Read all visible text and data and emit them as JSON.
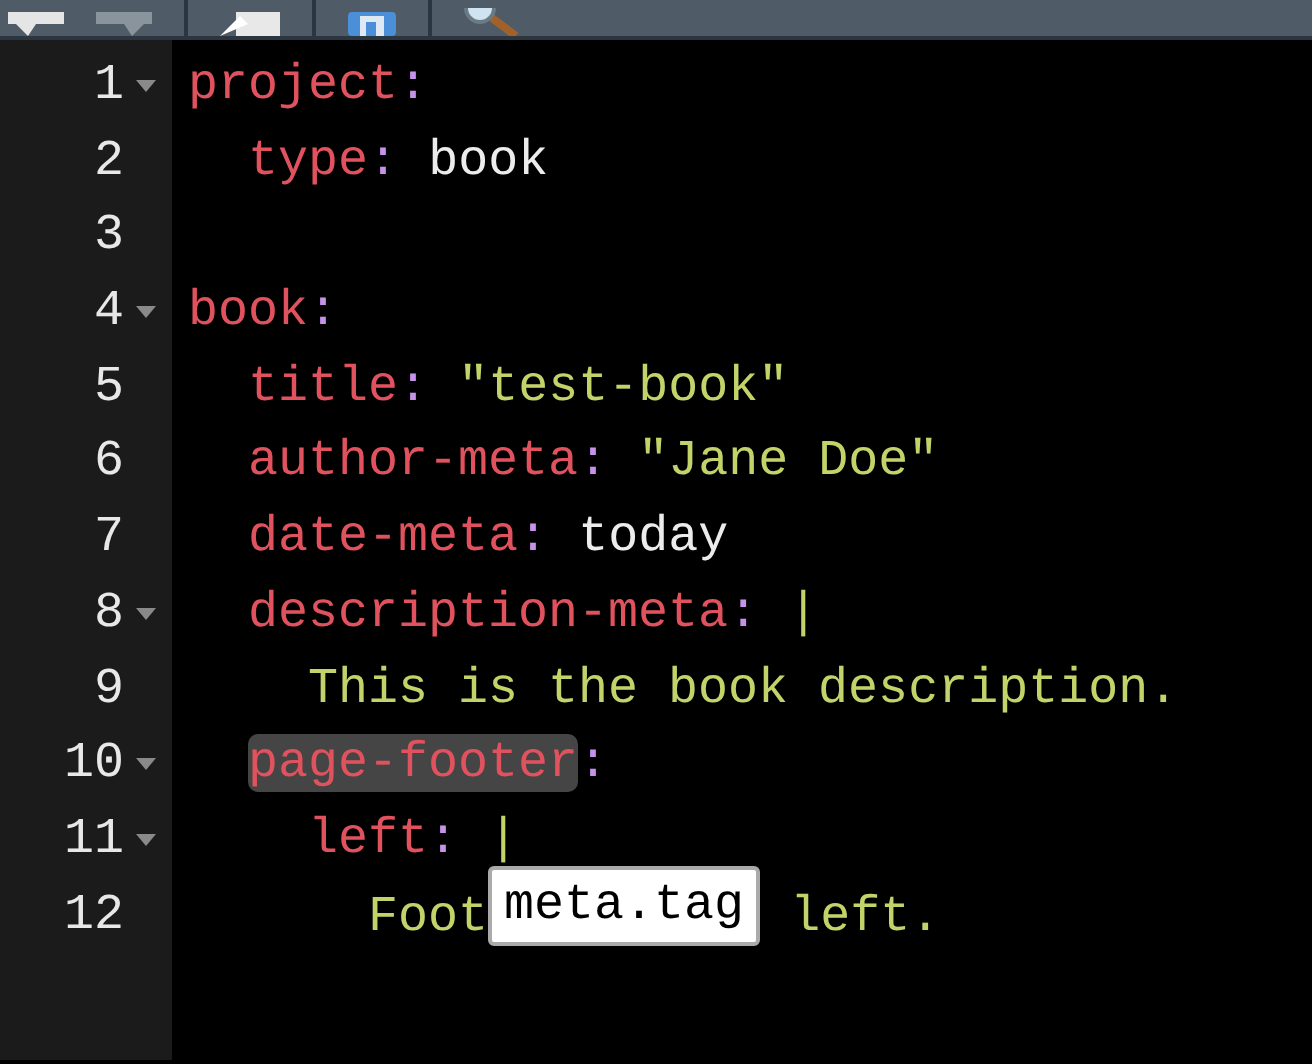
{
  "lines": [
    {
      "number": "1",
      "foldable": true,
      "tokens": [
        {
          "kind": "key",
          "text": "project"
        },
        {
          "kind": "colon",
          "text": ":"
        }
      ]
    },
    {
      "number": "2",
      "foldable": false,
      "tokens": [
        {
          "kind": "key",
          "text": "  type"
        },
        {
          "kind": "colon",
          "text": ":"
        },
        {
          "kind": "plain",
          "text": " book"
        }
      ]
    },
    {
      "number": "3",
      "foldable": false
    },
    {
      "number": "4",
      "foldable": true,
      "tokens": [
        {
          "kind": "key",
          "text": "book"
        },
        {
          "kind": "colon",
          "text": ":"
        }
      ]
    },
    {
      "number": "5",
      "foldable": false,
      "tokens": [
        {
          "kind": "key",
          "text": "  title"
        },
        {
          "kind": "colon",
          "text": ":"
        },
        {
          "kind": "string",
          "text": " \"test-book\""
        }
      ]
    },
    {
      "number": "6",
      "foldable": false,
      "tokens": [
        {
          "kind": "key",
          "text": "  author-meta"
        },
        {
          "kind": "colon",
          "text": ":"
        },
        {
          "kind": "string",
          "text": " \"Jane Doe\""
        }
      ]
    },
    {
      "number": "7",
      "foldable": false,
      "tokens": [
        {
          "kind": "key",
          "text": "  date-meta"
        },
        {
          "kind": "colon",
          "text": ":"
        },
        {
          "kind": "plain",
          "text": " today"
        }
      ]
    },
    {
      "number": "8",
      "foldable": true,
      "tokens": [
        {
          "kind": "key",
          "text": "  description-meta"
        },
        {
          "kind": "colon",
          "text": ":"
        },
        {
          "kind": "string",
          "text": " |"
        }
      ]
    },
    {
      "number": "9",
      "foldable": false,
      "tokens": [
        {
          "kind": "string",
          "text": "    This is the book description."
        }
      ]
    },
    {
      "number": "10",
      "foldable": true,
      "tokens": [
        {
          "kind": "key",
          "text": "  page-footer",
          "highlighted": true
        },
        {
          "kind": "colon",
          "text": ":"
        }
      ]
    },
    {
      "number": "11",
      "foldable": true,
      "tokens": [
        {
          "kind": "key",
          "text": "    left"
        },
        {
          "kind": "colon",
          "text": ":"
        },
        {
          "kind": "string",
          "text": " |"
        }
      ]
    },
    {
      "number": "12",
      "foldable": false,
      "tokens": [
        {
          "kind": "string",
          "text": "      Foot"
        },
        {
          "kind": "tooltip",
          "text": "meta.tag"
        },
        {
          "kind": "string",
          "text": " left."
        }
      ]
    }
  ]
}
